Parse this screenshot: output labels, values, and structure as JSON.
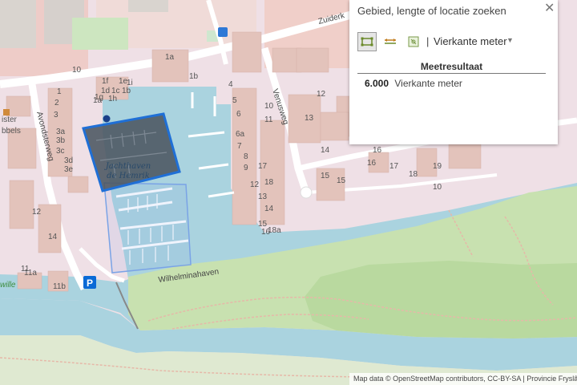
{
  "map": {
    "marina_label_line1": "Jachthaven",
    "marina_label_line2": "de Hemrik",
    "street_avondster": "Avondsterweg",
    "street_venus": "Venusweg",
    "street_zuiderk": "Zuiderk",
    "street_wilhelmina": "Wilhelminahaven",
    "parking_label": "P",
    "left_label_1": "ister",
    "left_label_2": "bbels",
    "left_label_3": "wille",
    "house_numbers": [
      "1a",
      "1b",
      "1f",
      "1e",
      "1d",
      "1c",
      "1b",
      "1a",
      "1g",
      "1h",
      "1i",
      "1",
      "2",
      "3",
      "3a",
      "3b",
      "3c",
      "3d",
      "3e",
      "4",
      "5",
      "6",
      "6a",
      "7",
      "8",
      "9",
      "10",
      "11",
      "12",
      "13",
      "14",
      "15",
      "16",
      "17",
      "18",
      "18a",
      "12",
      "14",
      "15",
      "16",
      "16",
      "10",
      "11",
      "11a",
      "11b",
      "10",
      "12",
      "13",
      "14",
      "15",
      "16",
      "17",
      "18",
      "19"
    ]
  },
  "panel": {
    "search_text": "Gebied, lengte of locatie zoeken",
    "close_symbol": "✕",
    "separator": "|",
    "unit_select": "Vierkante meter",
    "result_header": "Meetresultaat",
    "result_value": "6.000",
    "result_unit": "Vierkante meter"
  },
  "attribution": "Map data © OpenStreetMap contributors, CC-BY-SA | Provincie Fryslân | P",
  "colors": {
    "water": "#aad3df",
    "green": "#c8e1b0",
    "residential": "#f1dfe7",
    "building": "#e9c9c0",
    "measured_area": "#4a5560",
    "measure_border": "#2a73d6"
  }
}
